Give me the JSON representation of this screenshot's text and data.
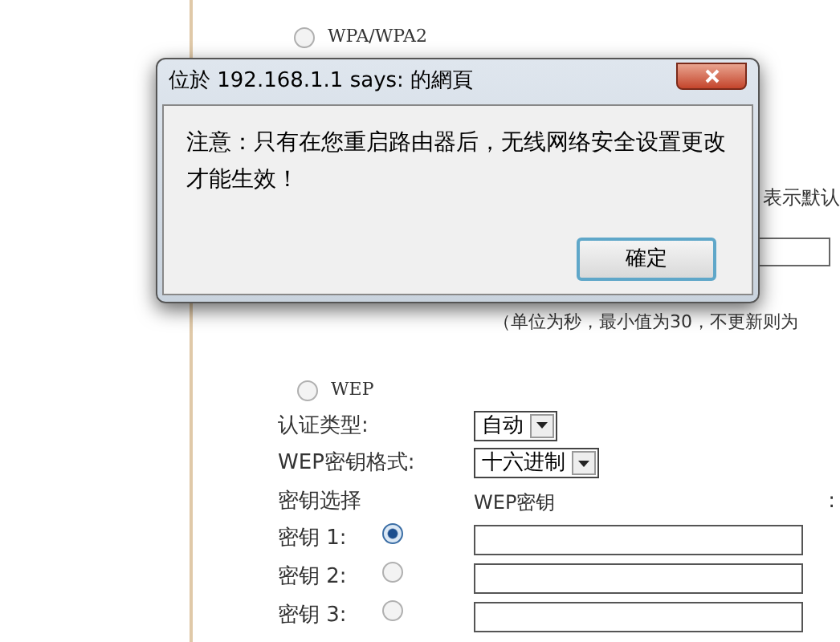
{
  "page": {
    "wpa_option": {
      "label": "WPA/WPA2",
      "selected": false
    },
    "partial_text": "表示默认",
    "note": "（单位为秒，最小值为30，不更新则为",
    "wep_option": {
      "label": "WEP",
      "selected": false
    },
    "auth_type": {
      "label": "认证类型:",
      "value": "自动"
    },
    "key_format": {
      "label": "WEP密钥格式:",
      "value": "十六进制"
    },
    "key_select_header": "密钥选择",
    "key_header": "WEP密钥",
    "column_3_header": ":",
    "keys": [
      {
        "label": "密钥 1:",
        "selected": true
      },
      {
        "label": "密钥 2:",
        "selected": false
      },
      {
        "label": "密钥 3:",
        "selected": false
      }
    ]
  },
  "dialog": {
    "title": "位於 192.168.1.1 says: 的網頁",
    "message": "注意：只有在您重启路由器后，无线网络安全设置更改才能生效！",
    "button": "確定"
  }
}
